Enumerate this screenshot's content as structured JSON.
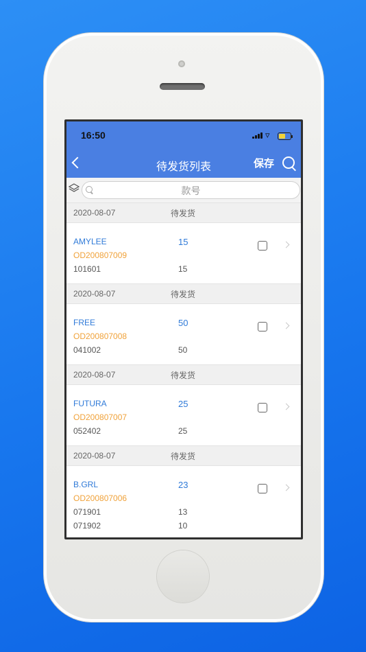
{
  "status_bar": {
    "time": "16:50"
  },
  "nav": {
    "title": "待发货列表",
    "save_label": "保存"
  },
  "search": {
    "placeholder": "款号"
  },
  "groups": [
    {
      "date": "2020-08-07",
      "status": "待发货",
      "customer": "AMYLEE",
      "total": "15",
      "order_no": "OD200807009",
      "lines": [
        {
          "style": "101601",
          "qty": "15"
        }
      ]
    },
    {
      "date": "2020-08-07",
      "status": "待发货",
      "customer": "FREE",
      "total": "50",
      "order_no": "OD200807008",
      "lines": [
        {
          "style": "041002",
          "qty": "50"
        }
      ]
    },
    {
      "date": "2020-08-07",
      "status": "待发货",
      "customer": "FUTURA",
      "total": "25",
      "order_no": "OD200807007",
      "lines": [
        {
          "style": "052402",
          "qty": "25"
        }
      ]
    },
    {
      "date": "2020-08-07",
      "status": "待发货",
      "customer": "B.GRL",
      "total": "23",
      "order_no": "OD200807006",
      "lines": [
        {
          "style": "071901",
          "qty": "13"
        },
        {
          "style": "071902",
          "qty": "10"
        }
      ]
    }
  ],
  "colors": {
    "nav_blue": "#4a7fe2",
    "link_blue": "#2f7ad8",
    "order_orange": "#f0a23a"
  }
}
